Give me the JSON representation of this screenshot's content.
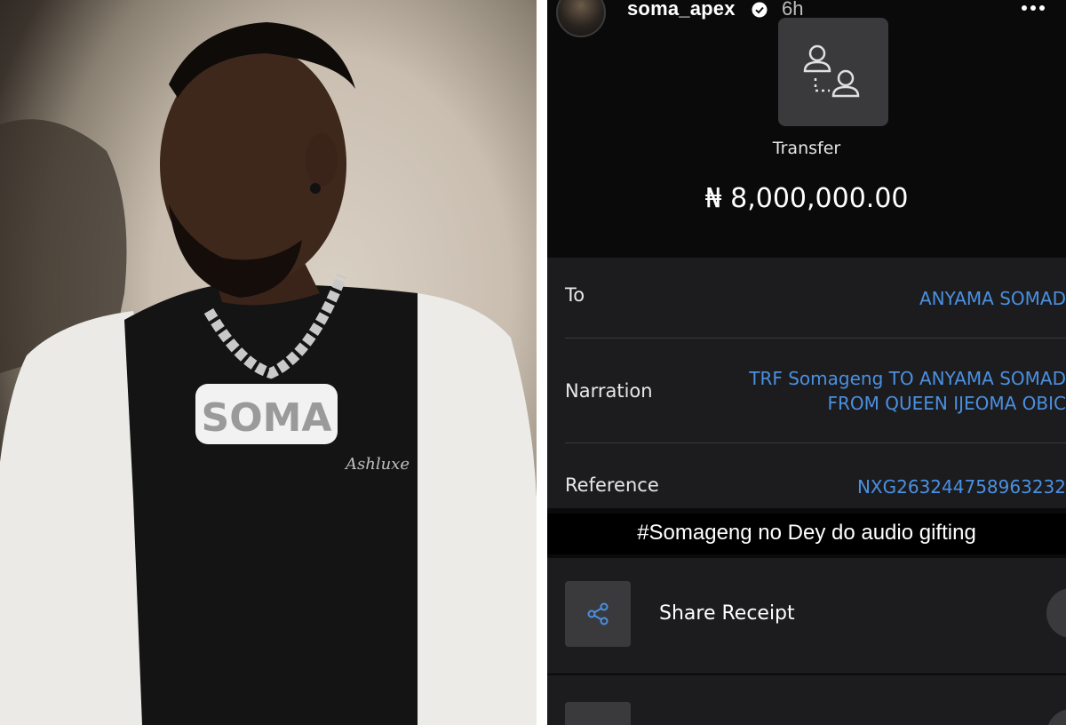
{
  "story": {
    "username": "soma_apex",
    "time_ago": "6h"
  },
  "photo": {
    "necklace_text": "SOMA",
    "shirt_text": "Ashluxe"
  },
  "receipt": {
    "transaction_type": "Transfer",
    "amount": "₦ 8,000,000.00",
    "to_label": "To",
    "to_value": "ANYAMA SOMAD",
    "narration_label": "Narration",
    "narration_line1": "TRF Somageng TO ANYAMA SOMAD",
    "narration_line2": "FROM QUEEN IJEOMA OBIC",
    "reference_label": "Reference",
    "reference_value": "NXG263244758963232",
    "caption": "#Somageng no Dey do audio gifting",
    "share_label": "Share Receipt"
  },
  "colors": {
    "link_blue": "#4a90e2",
    "card_bg": "#1c1c1e",
    "tile_bg": "#3a3a3c"
  }
}
